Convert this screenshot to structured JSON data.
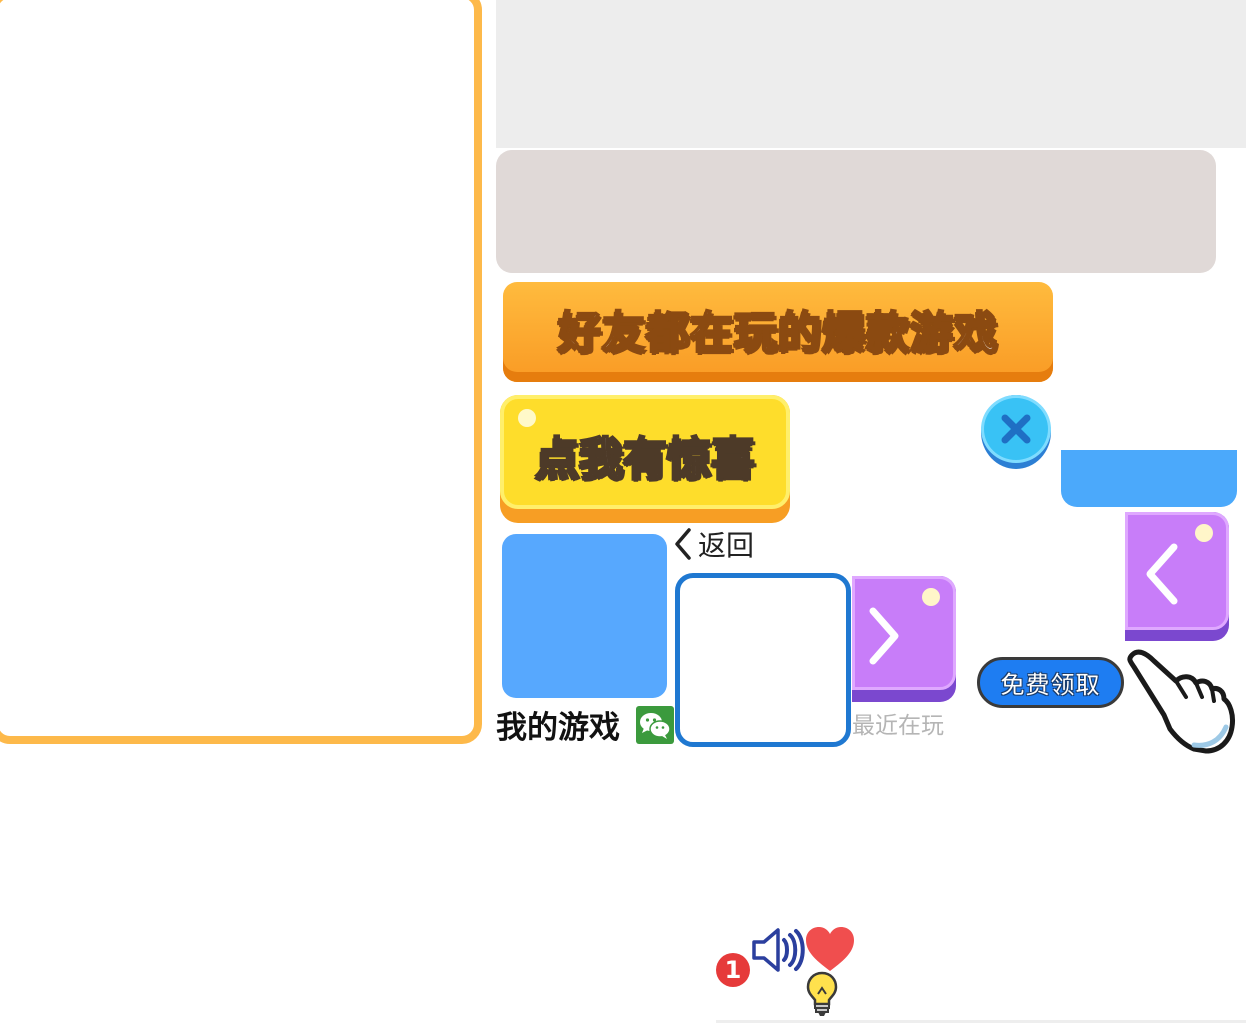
{
  "banner": {
    "title": "好友都在玩的爆款游戏"
  },
  "surprise_button": {
    "label": "点我有惊喜"
  },
  "back_link": {
    "label": "返回"
  },
  "my_games": {
    "label": "我的游戏"
  },
  "recent": {
    "label": "最近在玩"
  },
  "free_claim": {
    "label": "免费领取"
  },
  "notification_badge": {
    "count": "1"
  },
  "icons": {
    "close": "close-icon",
    "back": "chevron-left-icon",
    "next": "chevron-right-icon",
    "prev": "chevron-left-icon",
    "wechat": "wechat-icon",
    "hand": "pointing-hand-icon",
    "speaker": "speaker-icon",
    "heart": "heart-icon",
    "bulb": "lightbulb-icon"
  },
  "colors": {
    "panel_border": "#fdb94a",
    "banner_orange": "#f99a24",
    "surprise_yellow": "#fedd2b",
    "close_cyan": "#39c2f5",
    "blue": "#57a8fe",
    "purple": "#c87df9",
    "claim_blue": "#1e7df2",
    "heart_red": "#f04e4e"
  }
}
